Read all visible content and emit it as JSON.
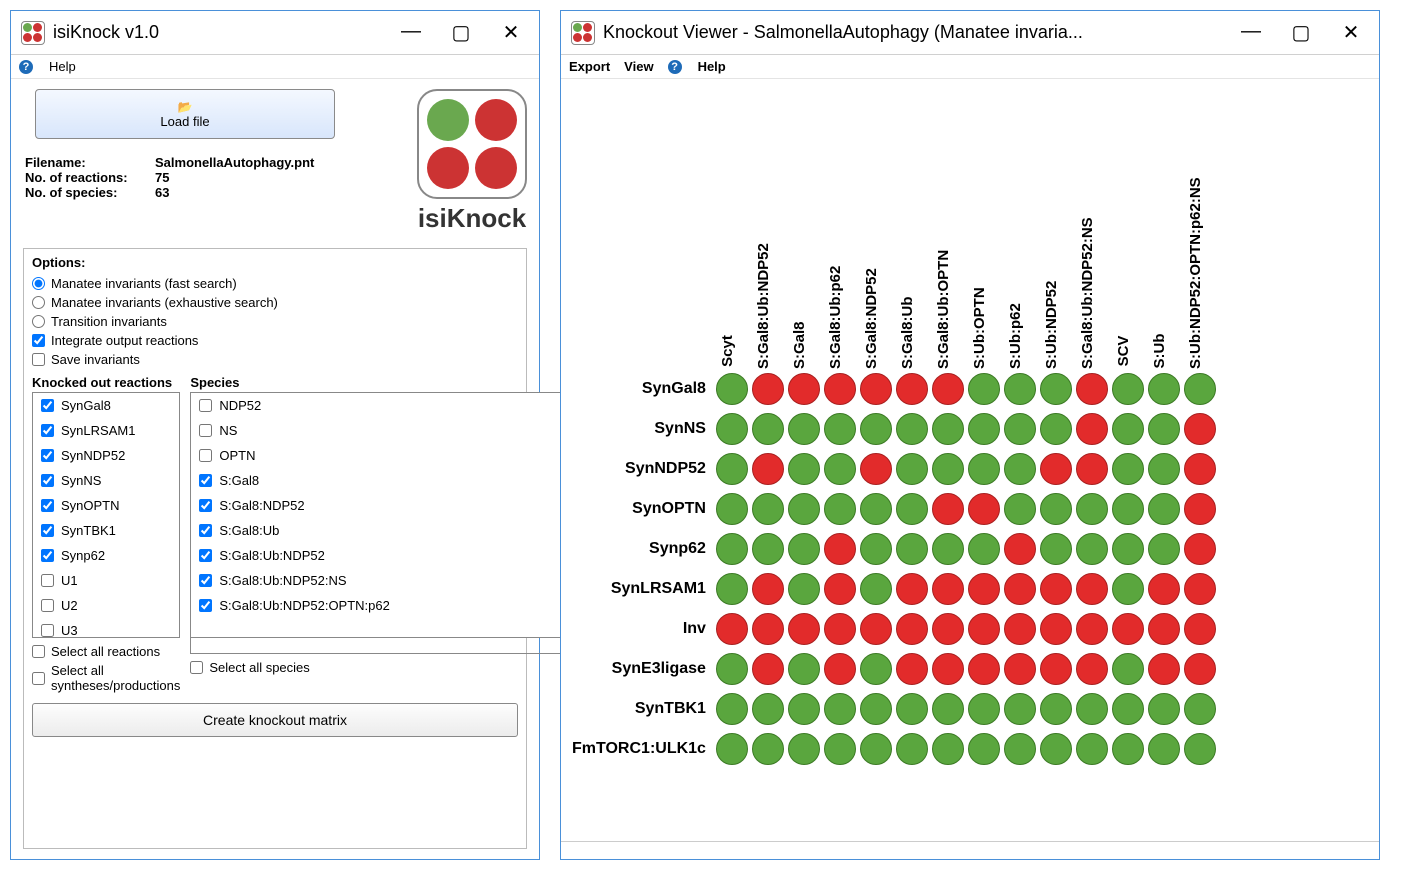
{
  "leftWindow": {
    "title": "isiKnock v1.0",
    "helpMenu": "Help",
    "loadFileLabel": "Load file",
    "meta": {
      "filenameLabel": "Filename:",
      "filenameValue": "SalmonellaAutophagy.pnt",
      "reactionsLabel": "No. of reactions:",
      "reactionsValue": "75",
      "speciesLabel": "No. of species:",
      "speciesValue": "63"
    },
    "logoText": "isiKnock",
    "optionsLabel": "Options:",
    "radios": {
      "fast": "Manatee invariants (fast search)",
      "exh": "Manatee invariants (exhaustive search)",
      "trans": "Transition invariants"
    },
    "checks": {
      "integrate": "Integrate output reactions",
      "save": "Save invariants"
    },
    "reactionsHeading": "Knocked out reactions",
    "speciesHeading": "Species",
    "reactions": [
      {
        "label": "SynGal8",
        "checked": true
      },
      {
        "label": "SynLRSAM1",
        "checked": true
      },
      {
        "label": "SynNDP52",
        "checked": true
      },
      {
        "label": "SynNS",
        "checked": true
      },
      {
        "label": "SynOPTN",
        "checked": true
      },
      {
        "label": "SynTBK1",
        "checked": true
      },
      {
        "label": "Synp62",
        "checked": true
      },
      {
        "label": "U1",
        "checked": false
      },
      {
        "label": "U2",
        "checked": false
      },
      {
        "label": "U3",
        "checked": false
      }
    ],
    "species": [
      {
        "label": "NDP52",
        "checked": false
      },
      {
        "label": "NS",
        "checked": false
      },
      {
        "label": "OPTN",
        "checked": false
      },
      {
        "label": "S:Gal8",
        "checked": true
      },
      {
        "label": "S:Gal8:NDP52",
        "checked": true
      },
      {
        "label": "S:Gal8:Ub",
        "checked": true
      },
      {
        "label": "S:Gal8:Ub:NDP52",
        "checked": true
      },
      {
        "label": "S:Gal8:Ub:NDP52:NS",
        "checked": true
      },
      {
        "label": "S:Gal8:Ub:NDP52:OPTN:p62",
        "checked": true
      }
    ],
    "selAllReactions": "Select all reactions",
    "selAllSpecies": "Select all species",
    "selAllSynth": "Select all syntheses/productions",
    "createBtn": "Create knockout matrix"
  },
  "rightWindow": {
    "title": "Knockout Viewer - SalmonellaAutophagy (Manatee invaria...",
    "menus": {
      "export": "Export",
      "view": "View",
      "help": "Help"
    }
  },
  "chart_data": {
    "type": "heatmap",
    "cols": [
      "Scyt",
      "S:Gal8:Ub:NDP52",
      "S:Gal8",
      "S:Gal8:Ub:p62",
      "S:Gal8:NDP52",
      "S:Gal8:Ub",
      "S:Gal8:Ub:OPTN",
      "S:Ub:OPTN",
      "S:Ub:p62",
      "S:Ub:NDP52",
      "S:Gal8:Ub:NDP52:NS",
      "SCV",
      "S:Ub",
      "S:Ub:NDP52:OPTN:p62:NS"
    ],
    "rows": [
      "SynGal8",
      "SynNS",
      "SynNDP52",
      "SynOPTN",
      "Synp62",
      "SynLRSAM1",
      "Inv",
      "SynE3ligase",
      "SynTBK1",
      "FmTORC1:ULK1c"
    ],
    "values": [
      [
        "G",
        "R",
        "R",
        "R",
        "R",
        "R",
        "R",
        "G",
        "G",
        "G",
        "R",
        "G",
        "G",
        "G"
      ],
      [
        "G",
        "G",
        "G",
        "G",
        "G",
        "G",
        "G",
        "G",
        "G",
        "G",
        "R",
        "G",
        "G",
        "R"
      ],
      [
        "G",
        "R",
        "G",
        "G",
        "R",
        "G",
        "G",
        "G",
        "G",
        "R",
        "R",
        "G",
        "G",
        "R"
      ],
      [
        "G",
        "G",
        "G",
        "G",
        "G",
        "G",
        "R",
        "R",
        "G",
        "G",
        "G",
        "G",
        "G",
        "R"
      ],
      [
        "G",
        "G",
        "G",
        "R",
        "G",
        "G",
        "G",
        "G",
        "R",
        "G",
        "G",
        "G",
        "G",
        "R"
      ],
      [
        "G",
        "R",
        "G",
        "R",
        "G",
        "R",
        "R",
        "R",
        "R",
        "R",
        "R",
        "G",
        "R",
        "R"
      ],
      [
        "R",
        "R",
        "R",
        "R",
        "R",
        "R",
        "R",
        "R",
        "R",
        "R",
        "R",
        "R",
        "R",
        "R"
      ],
      [
        "G",
        "R",
        "G",
        "R",
        "G",
        "R",
        "R",
        "R",
        "R",
        "R",
        "R",
        "G",
        "R",
        "R"
      ],
      [
        "G",
        "G",
        "G",
        "G",
        "G",
        "G",
        "G",
        "G",
        "G",
        "G",
        "G",
        "G",
        "G",
        "G"
      ],
      [
        "G",
        "G",
        "G",
        "G",
        "G",
        "G",
        "G",
        "G",
        "G",
        "G",
        "G",
        "G",
        "G",
        "G"
      ]
    ]
  }
}
